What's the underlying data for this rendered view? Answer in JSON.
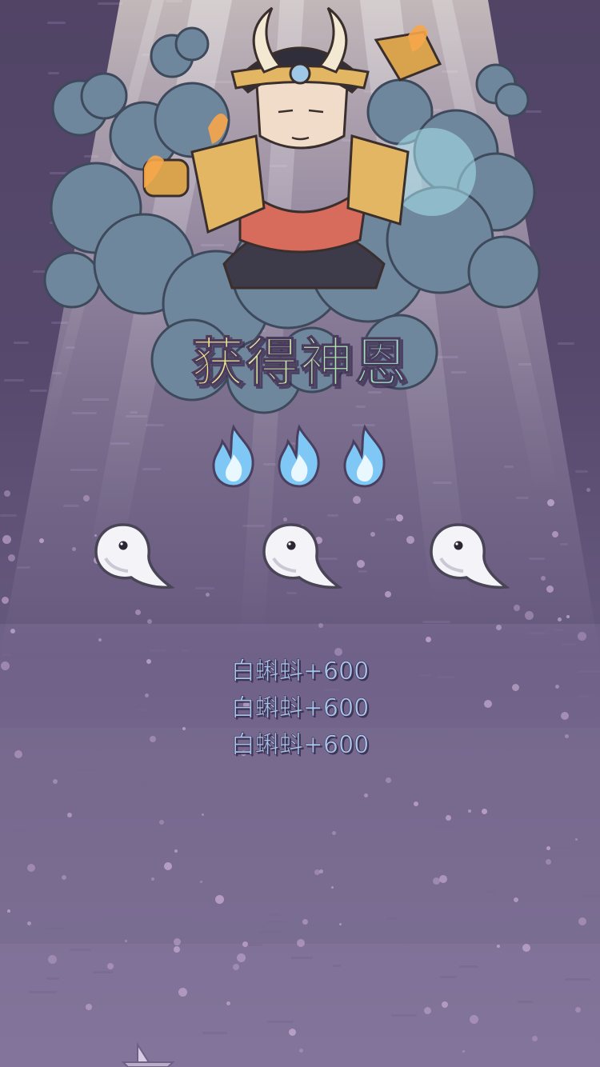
{
  "title": "获得神恩",
  "flame_icon": "blue-flame-icon",
  "flames": [
    {
      "name": "blue-flame-icon"
    },
    {
      "name": "blue-flame-icon"
    },
    {
      "name": "blue-flame-icon"
    }
  ],
  "spirit_icon": "white-tadpole-spirit-icon",
  "spirits": [
    {
      "name": "white-tadpole-spirit-icon"
    },
    {
      "name": "white-tadpole-spirit-icon"
    },
    {
      "name": "white-tadpole-spirit-icon"
    }
  ],
  "rewards": [
    {
      "text": "白蝌蚪+600"
    },
    {
      "text": "白蝌蚪+600"
    },
    {
      "text": "白蝌蚪+600"
    }
  ],
  "colors": {
    "background": "#5a4c6f",
    "reward_text": "#a9c4ec",
    "flame": "#7fc8f5",
    "cloud": "#6f879d"
  }
}
